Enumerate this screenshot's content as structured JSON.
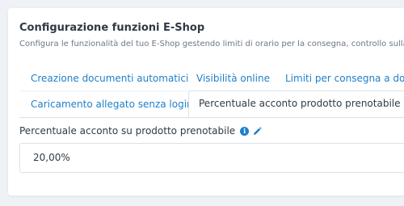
{
  "section": {
    "title": "Configurazione funzioni E-Shop",
    "subtitle": "Configura le funzionalità del tuo E-Shop gestendo limiti di orario per la consegna, controllo sulla dispo"
  },
  "tabs": [
    {
      "label": "Creazione documenti automatici",
      "active": false
    },
    {
      "label": "Visibilità online",
      "active": false
    },
    {
      "label": "Limiti per consegna a domi",
      "active": false
    },
    {
      "label": "Caricamento allegato senza login",
      "active": false
    },
    {
      "label": "Percentuale acconto prodotto prenotabile",
      "active": true
    }
  ],
  "field": {
    "label": "Percentuale acconto su prodotto prenotabile",
    "value": "20,00%"
  },
  "colors": {
    "accent": "#1e7fc9",
    "text": "#2f3a45",
    "muted": "#6c7884",
    "border": "#dde2e7"
  }
}
